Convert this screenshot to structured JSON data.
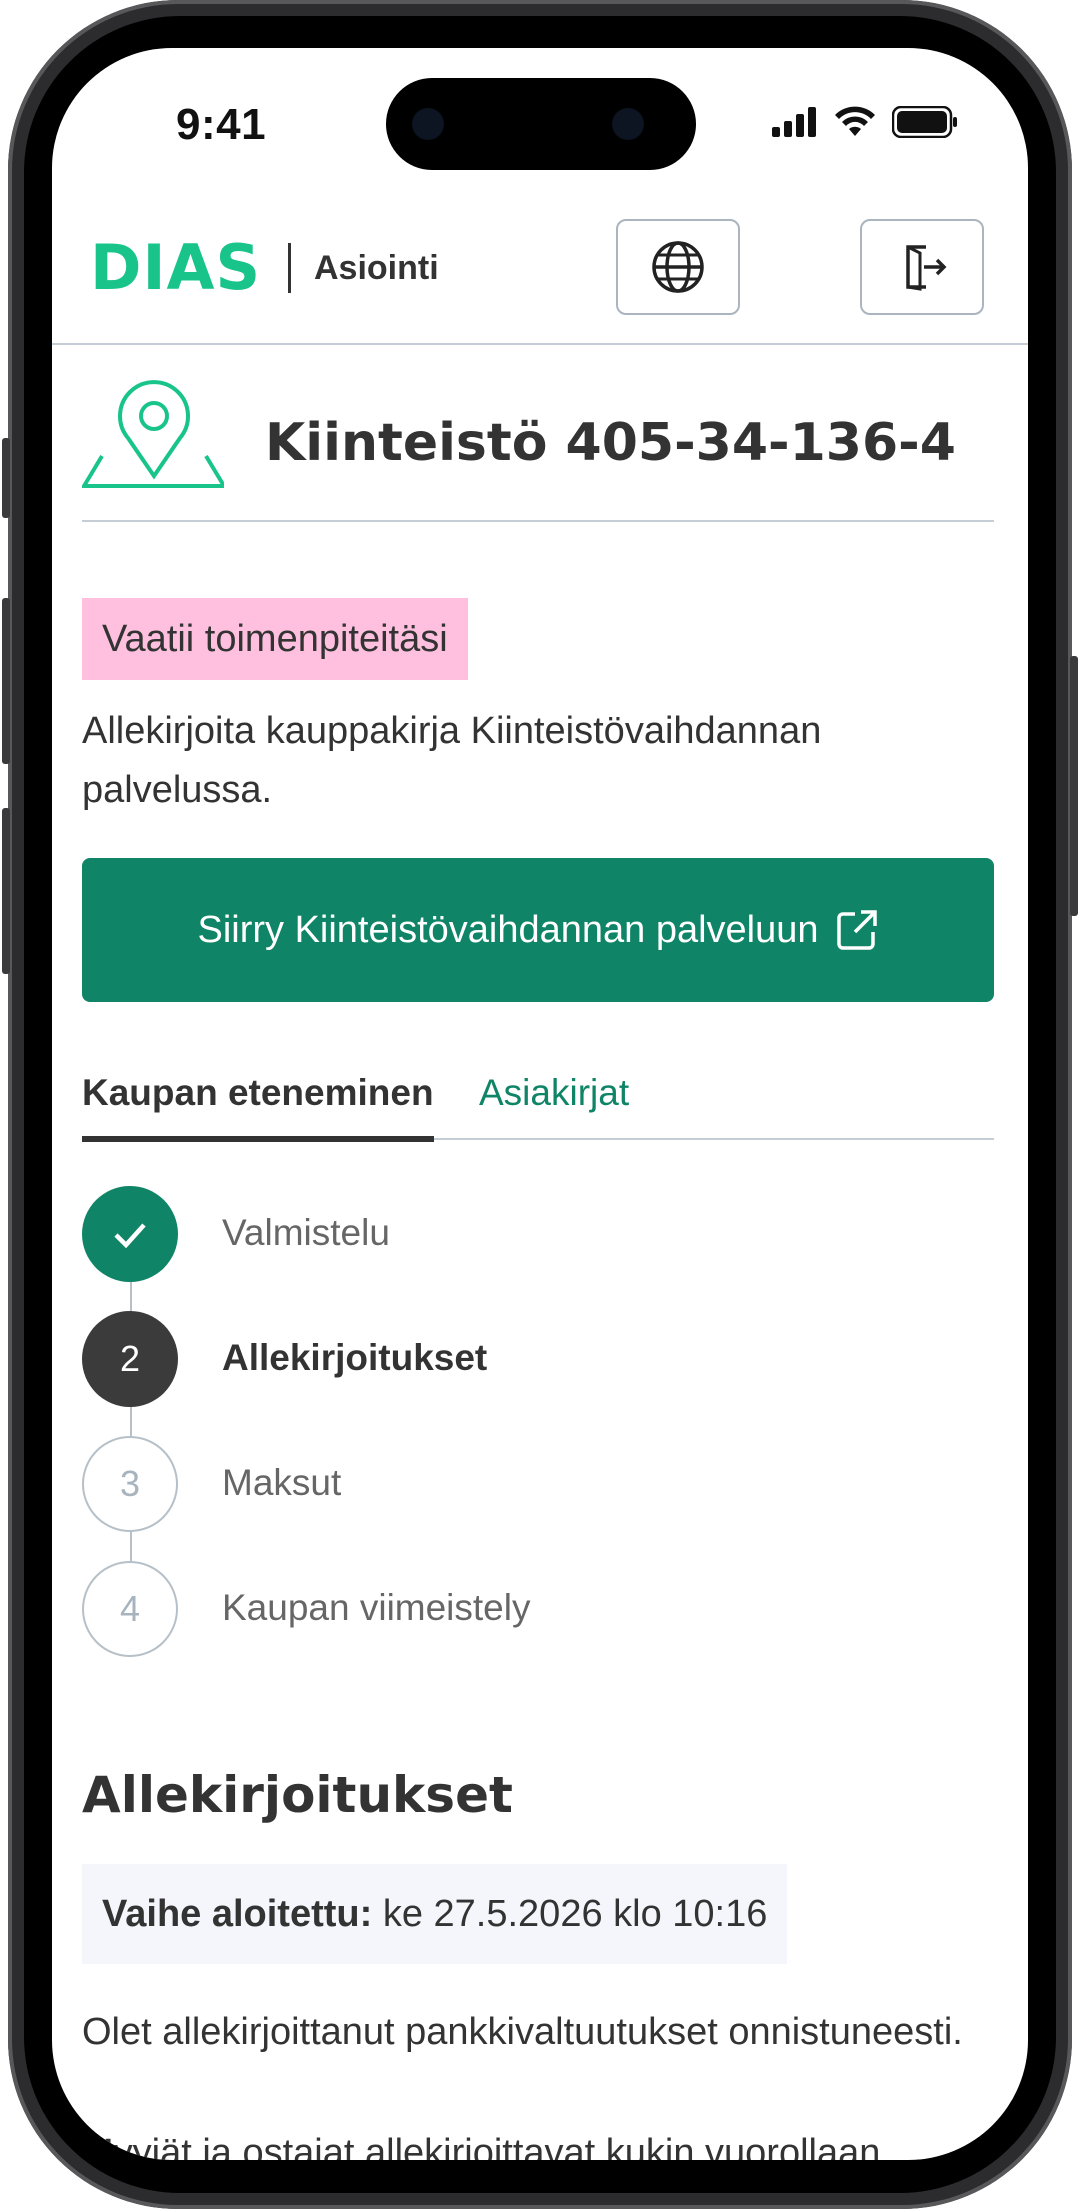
{
  "status_bar": {
    "time": "9:41"
  },
  "header": {
    "logo": "DIAS",
    "subtitle": "Asiointi"
  },
  "property": {
    "title": "Kiinteistö 405-34-136-4"
  },
  "notice": {
    "badge": "Vaatii toimenpiteitäsi",
    "message": "Allekirjoita kauppakirja Kiinteistövaihdannan palvelussa.",
    "button_label": "Siirry Kiinteistövaihdannan palveluun"
  },
  "tabs": [
    {
      "label": "Kaupan eteneminen"
    },
    {
      "label": "Asiakirjat"
    }
  ],
  "steps": [
    {
      "number": "",
      "label": "Valmistelu",
      "state": "done"
    },
    {
      "number": "2",
      "label": "Allekirjoitukset",
      "state": "active"
    },
    {
      "number": "3",
      "label": "Maksut",
      "state": "todo"
    },
    {
      "number": "4",
      "label": "Kaupan viimeistely",
      "state": "todo"
    }
  ],
  "section": {
    "title": "Allekirjoitukset",
    "phase_label": "Vaihe aloitettu:",
    "phase_value": " ke 27.5.2026 klo 10:16",
    "paragraph1": "Olet allekirjoittanut pankkivaltuutukset onnistuneesti.",
    "paragraph2": "Myyjät ja ostajat allekirjoittavat kukin vuorollaan"
  },
  "colors": {
    "brand": "#19c48a",
    "primary": "#0f8466",
    "badge": "#ffc0e0"
  },
  "icons": [
    "globe-icon",
    "logout-icon",
    "location-pin-icon",
    "external-link-icon",
    "check-icon"
  ]
}
